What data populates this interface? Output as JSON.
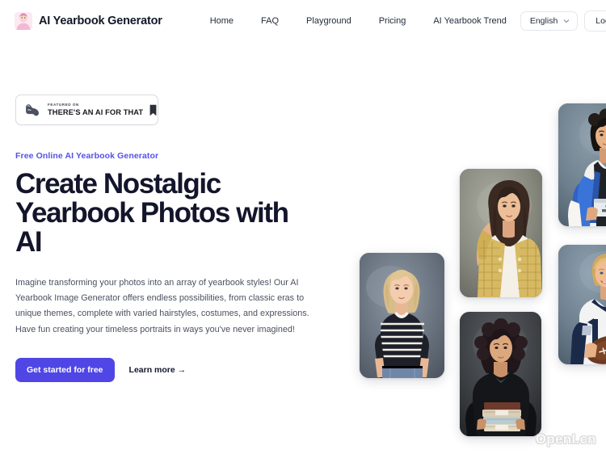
{
  "header": {
    "brand": {
      "name": "AI Yearbook Generator",
      "logo_icon": "portrait-avatar-logo"
    },
    "nav_links": [
      {
        "label": "Home"
      },
      {
        "label": "FAQ"
      },
      {
        "label": "Playground"
      },
      {
        "label": "Pricing"
      },
      {
        "label": "AI Yearbook Trend"
      }
    ],
    "language": {
      "selected": "English",
      "chevron_icon": "chevron-down-icon"
    },
    "login_label": "Login"
  },
  "hero": {
    "badge": {
      "kicker": "FEATURED ON",
      "title": "THERE'S AN AI FOR THAT",
      "left_icon": "flexed-bicep-icon",
      "right_icon": "bookmark-mark-icon"
    },
    "eyebrow": "Free Online AI Yearbook Generator",
    "headline": "Create Nostalgic Yearbook Photos with AI",
    "paragraph": "Imagine transforming your photos into an array of yearbook styles! Our AI Yearbook Image Generator offers endless possibilities, from classic eras to unique themes, complete with varied hairstyles, costumes, and expressions. Have fun creating your timeless portraits in ways you've never imagined!",
    "primary_cta": "Get started for free",
    "secondary_cta": "Learn more →"
  },
  "gallery": {
    "photos": [
      {
        "name": "blonde-striped-top-portrait",
        "alt": "Blonde woman in black and white striped top"
      },
      {
        "name": "tweed-jacket-portrait",
        "alt": "Woman in gold tweed jacket with hand in hair"
      },
      {
        "name": "black-turtleneck-portrait",
        "alt": "Woman in black turtleneck holding books"
      },
      {
        "name": "blue-vest-student-portrait",
        "alt": "Young man in blue vest holding a book"
      },
      {
        "name": "football-jersey-portrait",
        "alt": "Blond man in football jersey holding a football"
      }
    ]
  },
  "watermark": "OpenI.cn",
  "colors": {
    "accent": "#4f46e5",
    "eyebrow": "#5650e8",
    "heading": "#13152b",
    "body": "#4b5161",
    "border": "#e5e7eb"
  }
}
